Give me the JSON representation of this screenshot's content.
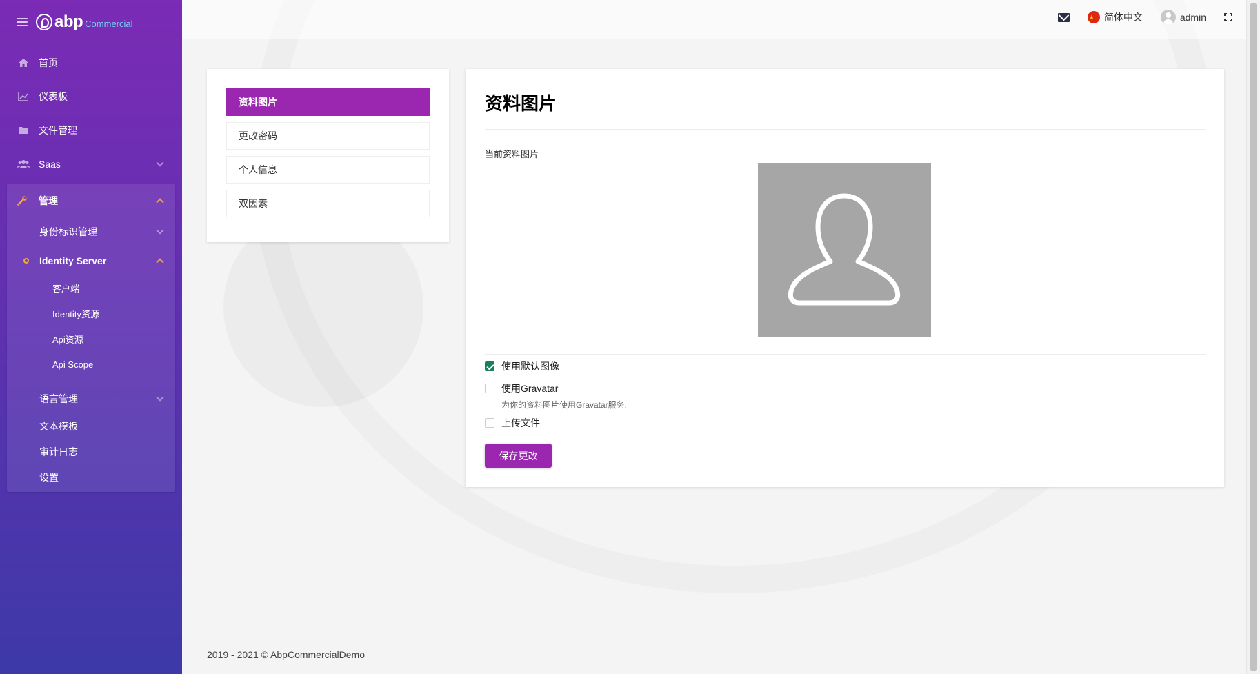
{
  "brand": {
    "logo_text": "abp",
    "logo_sub": "Commercial"
  },
  "sidebar": {
    "items": [
      {
        "label": "首页",
        "icon": "home-icon"
      },
      {
        "label": "仪表板",
        "icon": "chart-line-icon"
      },
      {
        "label": "文件管理",
        "icon": "folder-icon"
      },
      {
        "label": "Saas",
        "icon": "users-icon"
      }
    ],
    "admin": {
      "label": "管理",
      "icon": "wrench-icon",
      "children": [
        {
          "label": "身份标识管理"
        },
        {
          "label": "Identity Server"
        },
        {
          "label": "客户端"
        },
        {
          "label": "Identity资源"
        },
        {
          "label": "Api资源"
        },
        {
          "label": "Api Scope"
        },
        {
          "label": "语言管理"
        },
        {
          "label": "文本模板"
        },
        {
          "label": "审计日志"
        },
        {
          "label": "设置"
        }
      ]
    }
  },
  "topbar": {
    "language": "简体中文",
    "user": "admin"
  },
  "tabs": [
    {
      "label": "资料图片",
      "active": true
    },
    {
      "label": "更改密码"
    },
    {
      "label": "个人信息"
    },
    {
      "label": "双因素"
    }
  ],
  "main": {
    "title": "资料图片",
    "current_label": "当前资料图片",
    "options": [
      {
        "label": "使用默认图像",
        "checked": true
      },
      {
        "label": "使用Gravatar",
        "checked": false
      },
      {
        "label": "上传文件",
        "checked": false
      }
    ],
    "gravatar_help": "为你的资料图片使用Gravatar服务.",
    "save_label": "保存更改"
  },
  "footer": {
    "text": "2019 - 2021 © AbpCommercialDemo"
  },
  "colors": {
    "accent": "#9b27b0",
    "sidebar_top": "#7b2bb5",
    "sidebar_bottom": "#3d39a8",
    "checkbox": "#1a7f5d",
    "active_chevron": "#f6a93b"
  }
}
